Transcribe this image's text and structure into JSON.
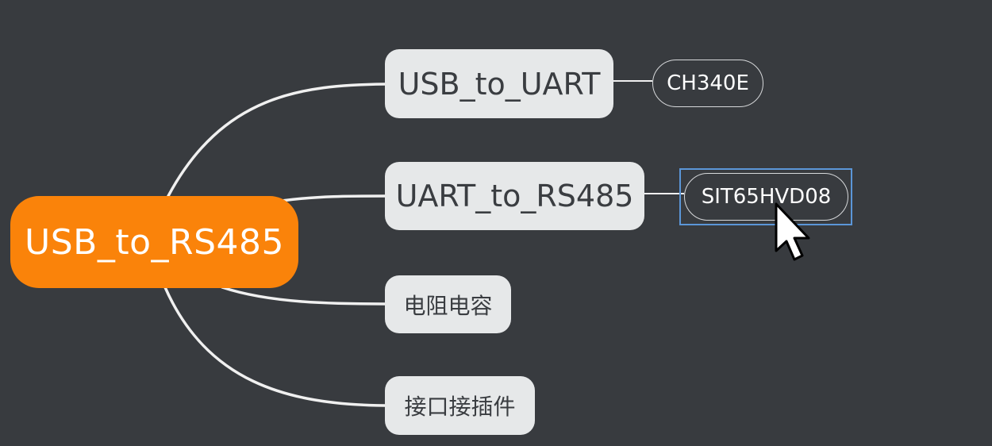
{
  "mindmap": {
    "root": {
      "label": "USB_to_RS485",
      "color": "#fa830a"
    },
    "branches": [
      {
        "label": "USB_to_UART",
        "child": "CH340E"
      },
      {
        "label": "UART_to_RS485",
        "child": "SIT65HVD08"
      },
      {
        "label": "电阻电容"
      },
      {
        "label": "接口接插件"
      }
    ]
  },
  "theme": {
    "background": "#383b3f",
    "branch_fill": "#e6e8e9",
    "link_color": "#f0f0f0",
    "selection_color": "#5b96d8"
  },
  "icons": {
    "cursor": "mouse-pointer-icon"
  }
}
